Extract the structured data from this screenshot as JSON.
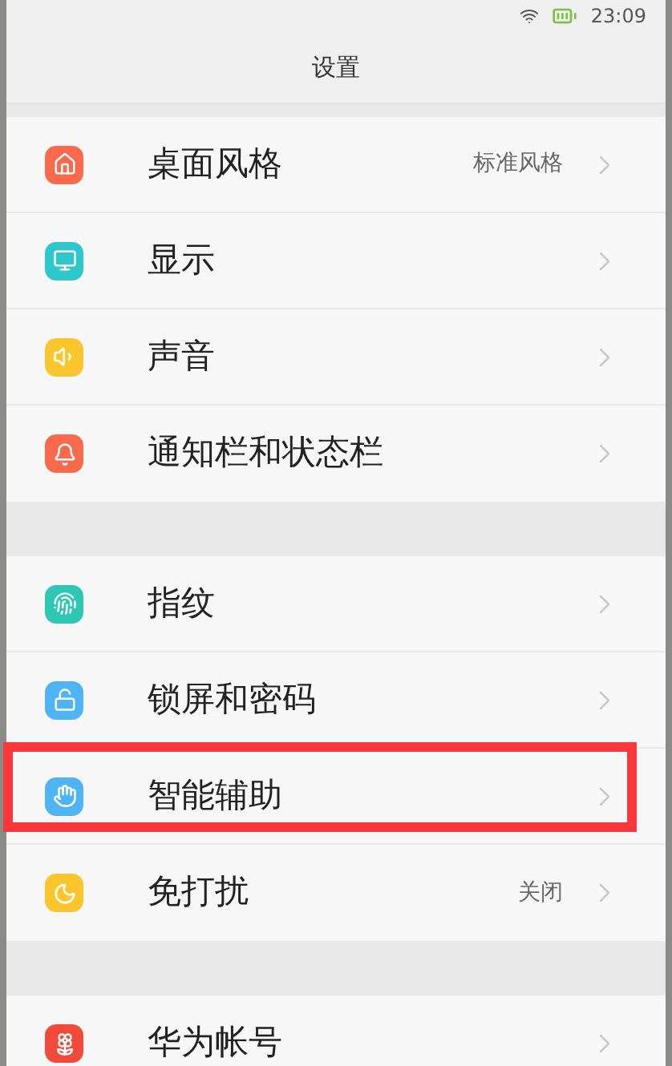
{
  "status_bar": {
    "time": "23:09"
  },
  "title": "设置",
  "groups": [
    {
      "items": [
        {
          "color": "#f9694c",
          "label": "桌面风格",
          "value": "标准风格",
          "highlighted": false
        },
        {
          "color": "#2ec7cc",
          "label": "显示",
          "highlighted": false
        },
        {
          "color": "#fbc52d",
          "label": "声音",
          "highlighted": false
        },
        {
          "color": "#f9694c",
          "label": "通知栏和状态栏",
          "highlighted": false
        }
      ]
    },
    {
      "items": [
        {
          "color": "#2ec7b4",
          "label": "指纹",
          "highlighted": false
        },
        {
          "color": "#4fb4f4",
          "label": "锁屏和密码",
          "highlighted": false
        },
        {
          "color": "#4fb4f4",
          "label": "智能辅助",
          "highlighted": true
        },
        {
          "color": "#fbc52d",
          "label": "免打扰",
          "value": "关闭",
          "highlighted": false
        }
      ]
    },
    {
      "items": [
        {
          "color": "#f14a3a",
          "label": "华为帐号",
          "highlighted": false
        }
      ]
    }
  ]
}
